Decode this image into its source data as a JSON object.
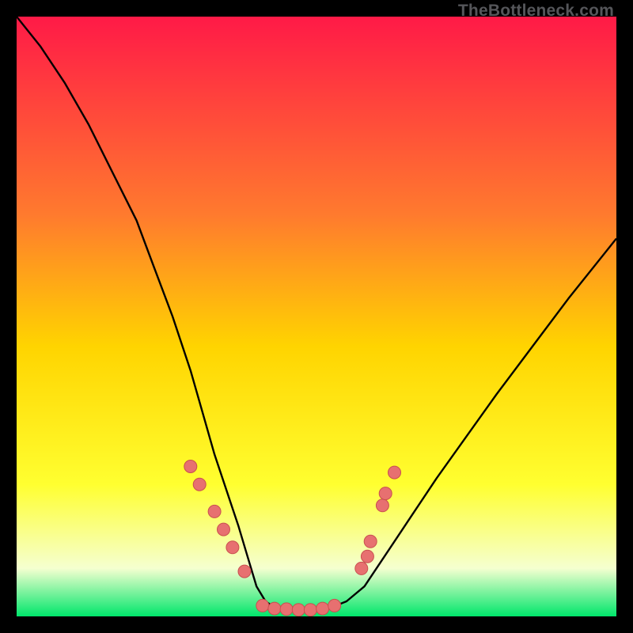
{
  "watermark": "TheBottleneck.com",
  "colors": {
    "frame": "#000000",
    "grad_top": "#ff1a47",
    "grad_mid1": "#ff7a2e",
    "grad_mid2": "#ffd400",
    "grad_mid3": "#ffff30",
    "grad_mid4": "#f5ffd0",
    "grad_bot": "#00e66b",
    "curve": "#000000",
    "marker_fill": "#e77070",
    "marker_stroke": "#c94f4f"
  },
  "chart_data": {
    "type": "line",
    "title": "",
    "xlabel": "",
    "ylabel": "",
    "xlim": [
      0,
      100
    ],
    "ylim": [
      0,
      100
    ],
    "series": [
      {
        "name": "bottleneck-curve",
        "x": [
          0,
          4,
          8,
          12,
          16,
          20,
          23,
          26,
          29,
          31,
          33,
          35,
          37,
          38.5,
          40,
          41.5,
          43,
          45,
          48,
          52,
          55,
          58,
          62,
          66,
          70,
          75,
          80,
          86,
          92,
          100
        ],
        "y": [
          100,
          95,
          89,
          82,
          74,
          66,
          58,
          50,
          41,
          34,
          27,
          21,
          15,
          10,
          5,
          2.5,
          1.5,
          1.2,
          1.0,
          1.3,
          2.5,
          5,
          11,
          17,
          23,
          30,
          37,
          45,
          53,
          63
        ]
      }
    ],
    "markers": [
      {
        "x": 29.0,
        "y": 25.0
      },
      {
        "x": 30.5,
        "y": 22.0
      },
      {
        "x": 33.0,
        "y": 17.5
      },
      {
        "x": 34.5,
        "y": 14.5
      },
      {
        "x": 36.0,
        "y": 11.5
      },
      {
        "x": 38.0,
        "y": 7.5
      },
      {
        "x": 41.0,
        "y": 1.8
      },
      {
        "x": 43.0,
        "y": 1.3
      },
      {
        "x": 45.0,
        "y": 1.2
      },
      {
        "x": 47.0,
        "y": 1.1
      },
      {
        "x": 49.0,
        "y": 1.1
      },
      {
        "x": 51.0,
        "y": 1.3
      },
      {
        "x": 53.0,
        "y": 1.8
      },
      {
        "x": 57.5,
        "y": 8.0
      },
      {
        "x": 58.5,
        "y": 10.0
      },
      {
        "x": 59.0,
        "y": 12.5
      },
      {
        "x": 61.0,
        "y": 18.5
      },
      {
        "x": 61.5,
        "y": 20.5
      },
      {
        "x": 63.0,
        "y": 24.0
      }
    ],
    "gradient_stops": [
      {
        "offset": 0.0,
        "color_key": "grad_top"
      },
      {
        "offset": 0.33,
        "color_key": "grad_mid1"
      },
      {
        "offset": 0.55,
        "color_key": "grad_mid2"
      },
      {
        "offset": 0.78,
        "color_key": "grad_mid3"
      },
      {
        "offset": 0.92,
        "color_key": "grad_mid4"
      },
      {
        "offset": 1.0,
        "color_key": "grad_bot"
      }
    ]
  }
}
